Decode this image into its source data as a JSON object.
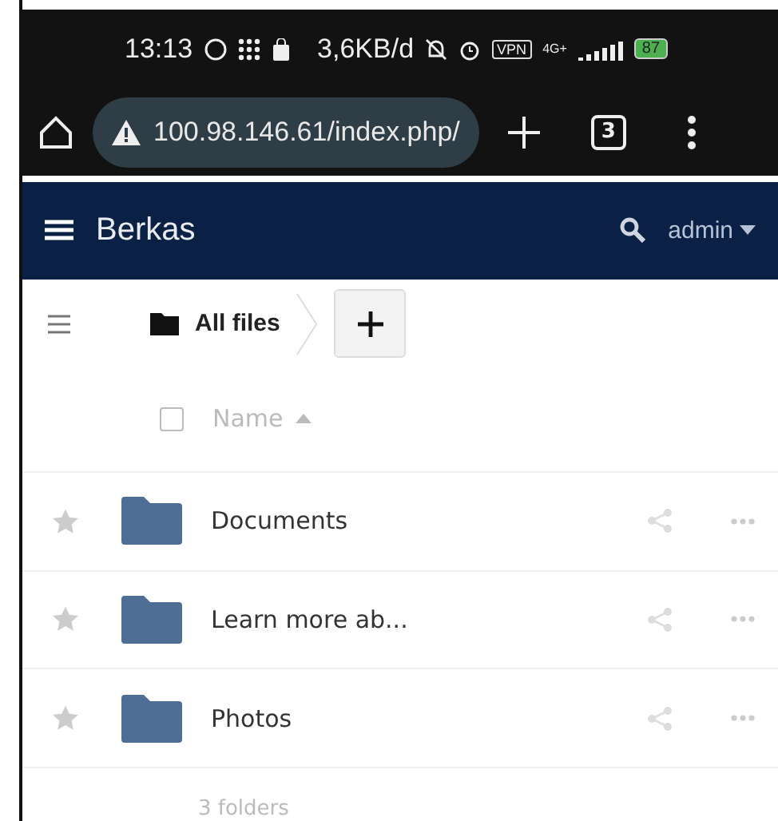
{
  "status_bar": {
    "time": "13:13",
    "speed": "3,6KB/d",
    "vpn": "VPN",
    "network": "4G+",
    "battery": "87"
  },
  "browser": {
    "url": "100.98.146.61/index.php/",
    "tab_count": "3"
  },
  "header": {
    "title": "Berkas",
    "user": "admin"
  },
  "breadcrumb": {
    "label": "All files"
  },
  "table": {
    "column": "Name",
    "select_all_checked": false,
    "rows": [
      {
        "name": "Documents",
        "favorite": false
      },
      {
        "name": "Learn more ab...",
        "favorite": false
      },
      {
        "name": "Photos",
        "favorite": false
      }
    ]
  },
  "summary": "3 folders"
}
